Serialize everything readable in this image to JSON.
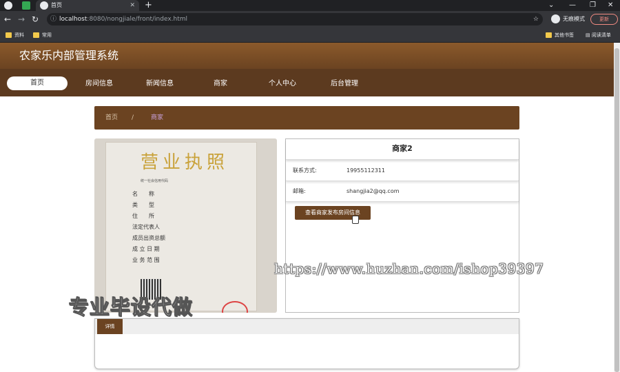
{
  "browser": {
    "tab_title": "首页",
    "new_tab": "+",
    "url_host": "localhost",
    "url_path": ":8080/nongjiale/front/index.html",
    "incognito_label": "无痕模式",
    "update_label": "更新",
    "bookmarks": [
      "资料",
      "常用"
    ],
    "bookmarks_right": [
      "其他书签",
      "阅读清单"
    ]
  },
  "site": {
    "title": "农家乐内部管理系统",
    "nav": [
      "首页",
      "房间信息",
      "新闻信息",
      "商家",
      "个人中心",
      "后台管理"
    ],
    "active_nav": "首页"
  },
  "breadcrumb": {
    "home": "首页",
    "sep": "/",
    "current": "商家"
  },
  "license": {
    "title": "营业执照",
    "subtitle": "统一社会信用代码",
    "rows": [
      "名　　称",
      "类　　型",
      "住　　所",
      "法定代表人",
      "成员出资总额",
      "成 立 日 期",
      "业 务 范 围"
    ]
  },
  "merchant": {
    "name": "商家2",
    "contact_label": "联系方式:",
    "contact_value": "19955112311",
    "email_label": "邮箱:",
    "email_value": "shangjia2@qq.com",
    "view_button": "查看商家发布房间信息"
  },
  "detail": {
    "tab": "详情"
  },
  "watermark": {
    "big": "专业毕设代做",
    "url": "https://www.huzhan.com/ishop39397"
  }
}
